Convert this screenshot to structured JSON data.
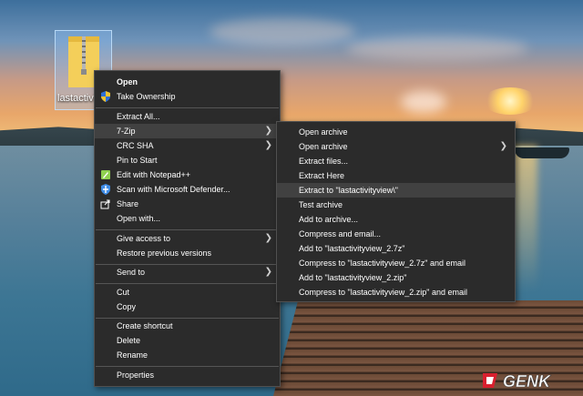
{
  "desktop": {
    "file_label": "lastactivityview"
  },
  "context_menu": {
    "items": [
      {
        "label": "Open",
        "bold": true,
        "icon": ""
      },
      {
        "label": "Take Ownership",
        "icon": "shield-icon"
      },
      {
        "label": "Extract All...",
        "icon": ""
      },
      {
        "label": "7-Zip",
        "icon": "",
        "submenu": true
      },
      {
        "label": "CRC SHA",
        "icon": "",
        "submenu": true
      },
      {
        "label": "Pin to Start",
        "icon": ""
      },
      {
        "label": "Edit with Notepad++",
        "icon": "notepad-icon"
      },
      {
        "label": "Scan with Microsoft Defender...",
        "icon": "defender-icon"
      },
      {
        "label": "Share",
        "icon": "share-icon"
      },
      {
        "label": "Open with...",
        "icon": ""
      },
      {
        "label": "Give access to",
        "icon": "",
        "submenu": true
      },
      {
        "label": "Restore previous versions",
        "icon": ""
      },
      {
        "label": "Send to",
        "icon": "",
        "submenu": true
      },
      {
        "label": "Cut",
        "icon": ""
      },
      {
        "label": "Copy",
        "icon": ""
      },
      {
        "label": "Create shortcut",
        "icon": ""
      },
      {
        "label": "Delete",
        "icon": ""
      },
      {
        "label": "Rename",
        "icon": ""
      },
      {
        "label": "Properties",
        "icon": ""
      }
    ]
  },
  "zip_submenu": {
    "items": [
      {
        "label": "Open archive"
      },
      {
        "label": "Open archive",
        "submenu": true
      },
      {
        "label": "Extract files..."
      },
      {
        "label": "Extract Here"
      },
      {
        "label": "Extract to \"lastactivityview\\\"",
        "highlighted": true
      },
      {
        "label": "Test archive"
      },
      {
        "label": "Add to archive..."
      },
      {
        "label": "Compress and email..."
      },
      {
        "label": "Add to \"lastactivityview_2.7z\""
      },
      {
        "label": "Compress to \"lastactivityview_2.7z\" and email"
      },
      {
        "label": "Add to \"lastactivityview_2.zip\""
      },
      {
        "label": "Compress to \"lastactivityview_2.zip\" and email"
      }
    ]
  },
  "watermark": {
    "text": "GENK"
  },
  "colors": {
    "menu_bg": "#2b2b2b",
    "menu_hover": "#414141",
    "menu_border": "#505050"
  }
}
